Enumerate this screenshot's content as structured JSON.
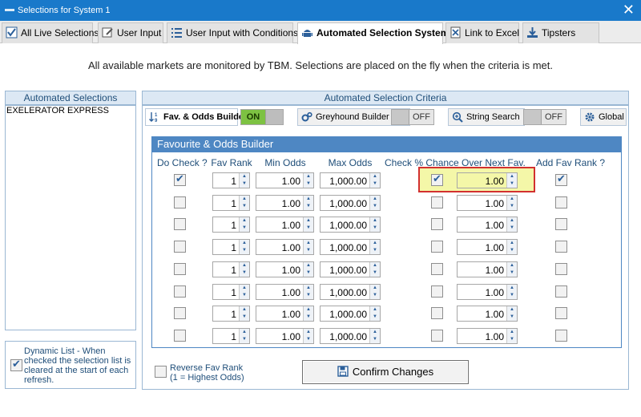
{
  "window": {
    "title": "Selections for System 1",
    "close_glyph": "✕"
  },
  "tabs": [
    {
      "label": "All Live Selections",
      "icon": "checkbox-icon",
      "active": false
    },
    {
      "label": "User Input",
      "icon": "edit-icon",
      "active": false
    },
    {
      "label": "User Input with Conditions",
      "icon": "list-icon",
      "active": false
    },
    {
      "label": "Automated Selection Systems",
      "icon": "android-icon",
      "active": true
    },
    {
      "label": "Link to Excel",
      "icon": "excel-icon",
      "active": false
    },
    {
      "label": "Tipsters",
      "icon": "download-icon",
      "active": false
    }
  ],
  "info_text": "All available markets are monitored by TBM. Selections are placed on the fly when the criteria is met.",
  "left_panel": {
    "title": "Automated Selections",
    "items": [
      "EXELERATOR EXPRESS"
    ],
    "dynamic_list_label": "Dynamic List - When checked the selection list is cleared at the start of each refresh.",
    "dynamic_list_checked": true
  },
  "criteria": {
    "title": "Automated Selection Criteria",
    "fav_builder_label": "Fav. & Odds Builder",
    "fav_toggle": "ON",
    "greyhound_label": "Greyhound Builder",
    "greyhound_toggle": "OFF",
    "string_search_label": "String Search",
    "string_toggle": "OFF",
    "global_label": "Global"
  },
  "builder": {
    "title": "Favourite & Odds Builder",
    "columns": {
      "do_check": "Do Check ?",
      "fav_rank": "Fav Rank",
      "min_odds": "Min Odds",
      "max_odds": "Max Odds",
      "chance": "Check % Chance Over Next Fav.",
      "add_rank": "Add Fav Rank ?"
    },
    "rows": [
      {
        "do_check": true,
        "fav_rank": "1",
        "min_odds": "1.00",
        "max_odds": "1,000.00",
        "chance_check": true,
        "chance": "1.00",
        "add_rank": true
      },
      {
        "do_check": false,
        "fav_rank": "1",
        "min_odds": "1.00",
        "max_odds": "1,000.00",
        "chance_check": false,
        "chance": "1.00",
        "add_rank": false
      },
      {
        "do_check": false,
        "fav_rank": "1",
        "min_odds": "1.00",
        "max_odds": "1,000.00",
        "chance_check": false,
        "chance": "1.00",
        "add_rank": false
      },
      {
        "do_check": false,
        "fav_rank": "1",
        "min_odds": "1.00",
        "max_odds": "1,000.00",
        "chance_check": false,
        "chance": "1.00",
        "add_rank": false
      },
      {
        "do_check": false,
        "fav_rank": "1",
        "min_odds": "1.00",
        "max_odds": "1,000.00",
        "chance_check": false,
        "chance": "1.00",
        "add_rank": false
      },
      {
        "do_check": false,
        "fav_rank": "1",
        "min_odds": "1.00",
        "max_odds": "1,000.00",
        "chance_check": false,
        "chance": "1.00",
        "add_rank": false
      },
      {
        "do_check": false,
        "fav_rank": "1",
        "min_odds": "1.00",
        "max_odds": "1,000.00",
        "chance_check": false,
        "chance": "1.00",
        "add_rank": false
      },
      {
        "do_check": false,
        "fav_rank": "1",
        "min_odds": "1.00",
        "max_odds": "1,000.00",
        "chance_check": false,
        "chance": "1.00",
        "add_rank": false
      }
    ]
  },
  "footer": {
    "reverse_label_line1": "Reverse Fav Rank",
    "reverse_label_line2": "(1 = Highest Odds)",
    "reverse_checked": false,
    "confirm_label": "Confirm Changes"
  },
  "colors": {
    "accent": "#1979ca",
    "header_blue": "#4e87c3",
    "toggle_on": "#7dc242",
    "highlight": "#f4f7a8",
    "highlight_border": "#d2302f"
  }
}
